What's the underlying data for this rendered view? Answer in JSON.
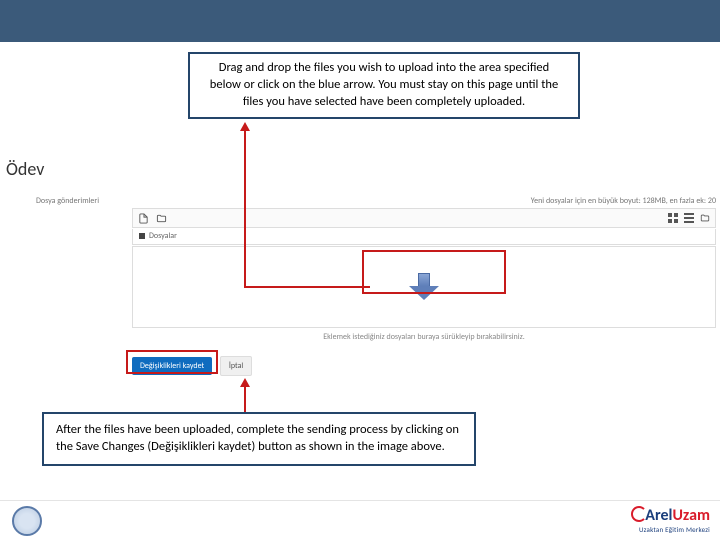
{
  "callouts": {
    "top": "Drag and drop the files you wish to upload into the area specified below or click on the blue arrow. You must stay on this page until the files you have selected have been completely uploaded.",
    "bottom": "After the files have been uploaded, complete the sending process by clicking on the Save Changes (Değişiklikleri kaydet) button as shown in the image above."
  },
  "screenshot": {
    "title": "Ödev",
    "field_label": "Dosya gönderimleri",
    "size_hint": "Yeni dosyalar için en büyük boyut: 128MB, en fazla ek: 20",
    "files_path": "Dosyalar",
    "dropzone_text": "Eklemek istediğiniz dosyaları buraya sürükleyip bırakabilirsiniz.",
    "buttons": {
      "save": "Değişiklikleri kaydet",
      "cancel": "İptal"
    }
  },
  "brand": {
    "main_a": "Arel",
    "main_b": "Uzam",
    "sub": "Uzaktan Eğitim Merkezi"
  }
}
